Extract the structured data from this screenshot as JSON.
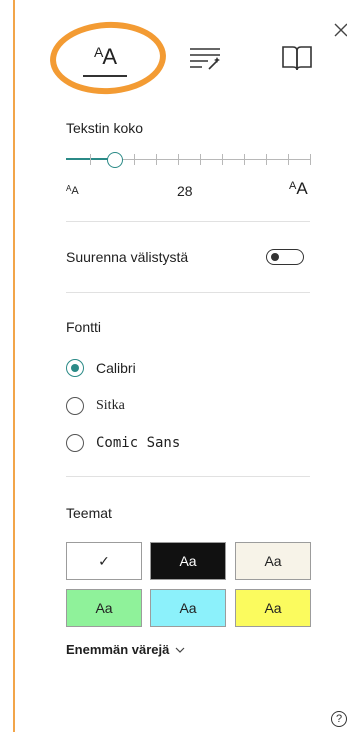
{
  "toolbar": {
    "text_options_glyph_small": "A",
    "text_options_glyph_large": "A",
    "tabs": [
      "text-options",
      "grammar-options",
      "reading-preferences"
    ]
  },
  "text_size": {
    "label": "Tekstin koko",
    "value": "28",
    "small_glyph_sup": "A",
    "small_glyph": "A",
    "large_glyph_sup": "A",
    "large_glyph": "A",
    "slider_level": 0.2
  },
  "spacing": {
    "label": "Suurenna välistystä",
    "enabled": false
  },
  "font": {
    "label": "Fontti",
    "options": [
      {
        "label": "Calibri",
        "selected": true
      },
      {
        "label": "Sitka",
        "selected": false
      },
      {
        "label": "Comic Sans",
        "selected": false
      }
    ]
  },
  "themes": {
    "label": "Teemat",
    "swatches": [
      {
        "label": "✓",
        "bg": "#ffffff",
        "fg": "#222222",
        "selected": true
      },
      {
        "label": "Aa",
        "bg": "#111111",
        "fg": "#ffffff"
      },
      {
        "label": "Aa",
        "bg": "#f7f3e8",
        "fg": "#222222"
      },
      {
        "label": "Aa",
        "bg": "#8ff29a",
        "fg": "#222222"
      },
      {
        "label": "Aa",
        "bg": "#8cf1fb",
        "fg": "#222222"
      },
      {
        "label": "Aa",
        "bg": "#fbfb5e",
        "fg": "#222222"
      }
    ],
    "more_colors": "Enemmän värejä"
  },
  "help": "?",
  "colors": {
    "accent": "#2b8a87",
    "highlight_ring": "#f39b33",
    "panel_border": "#f2a54a"
  }
}
